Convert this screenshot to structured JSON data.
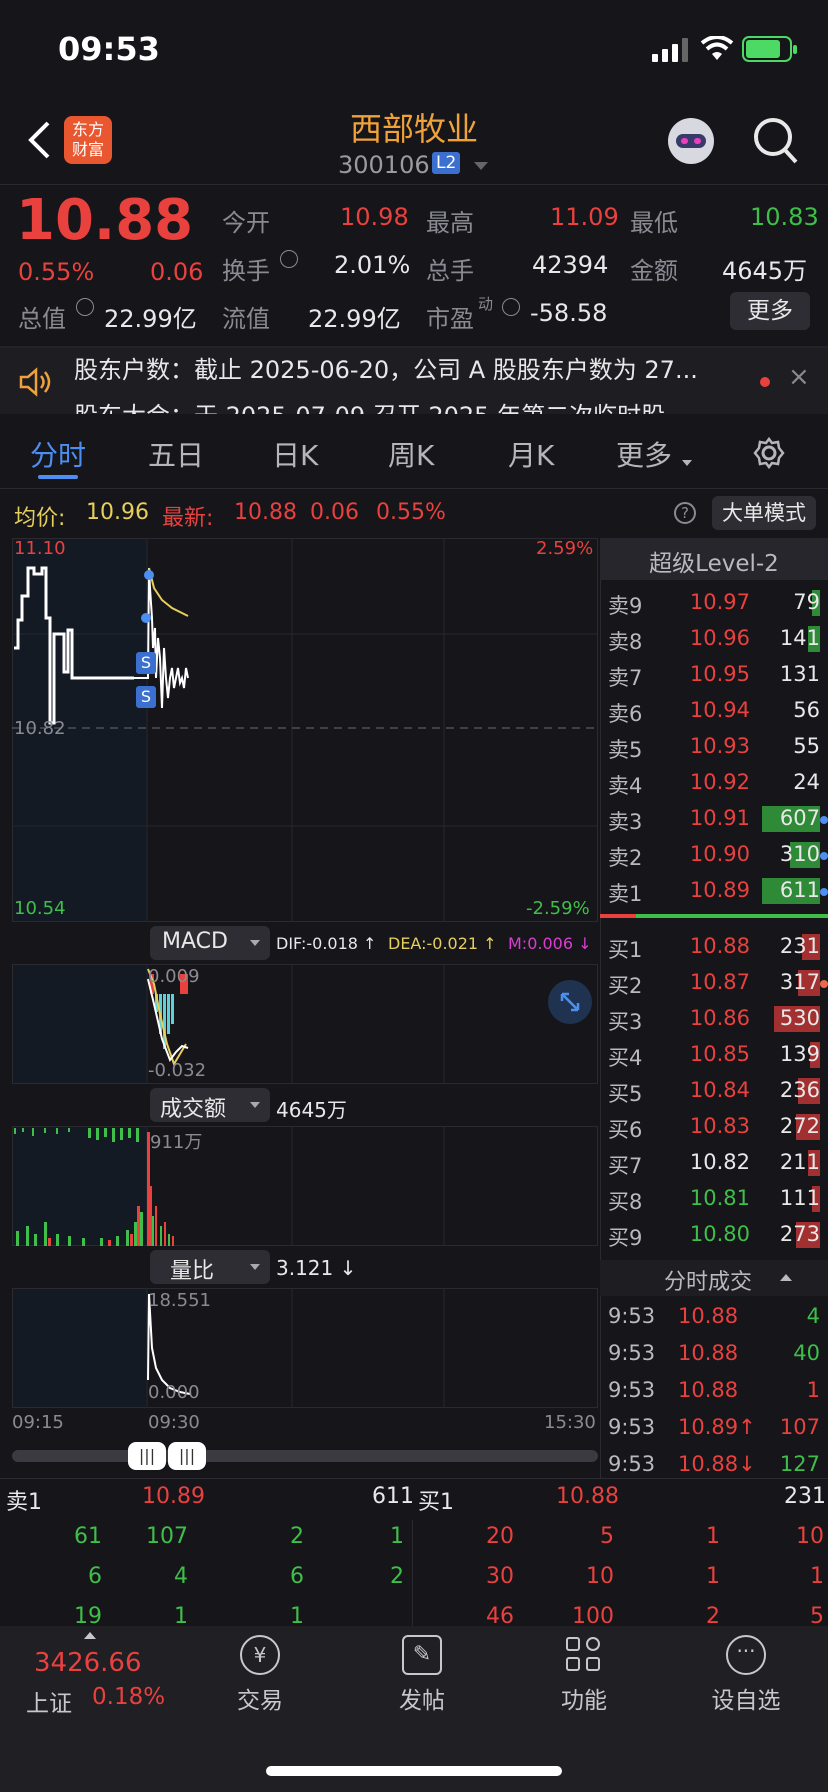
{
  "status_bar": {
    "time": "09:53"
  },
  "header": {
    "title": "西部牧业",
    "code": "300106",
    "level_badge": "L2",
    "logo_text": "东方财富"
  },
  "quote": {
    "price": "10.88",
    "change_pct": "0.55%",
    "change": "0.06",
    "open_label": "今开",
    "open": "10.98",
    "high_label": "最高",
    "high": "11.09",
    "low_label": "最低",
    "low": "10.83",
    "turnover_label": "换手",
    "turnover": "2.01%",
    "volume_label": "总手",
    "volume": "42394",
    "amount_label": "金额",
    "amount": "4645万",
    "mktcap_label": "总值",
    "mktcap": "22.99亿",
    "float_label": "流值",
    "float": "22.99亿",
    "pe_label": "市盈",
    "pe_sup": "动",
    "pe": "-58.58",
    "more_button": "更多"
  },
  "news": {
    "line1": "股东户数：截止 2025-06-20，公司 A 股股东户数为 27...",
    "line2": "股东大会：于 2025-07-09 召开 2025 年第二次临时股"
  },
  "tabs": [
    "分时",
    "五日",
    "日K",
    "周K",
    "月K",
    "更多"
  ],
  "info_line": {
    "avg_label": "均价:",
    "avg": "10.96",
    "latest_label": "最新:",
    "latest": "10.88",
    "chg": "0.06",
    "chg_pct": "0.55%",
    "mode_button": "大单模式"
  },
  "chart": {
    "price_top": "11.10",
    "price_mid": "10.82",
    "price_bottom": "10.54",
    "pct_top": "2.59%",
    "pct_bottom": "-2.59%",
    "macd_button": "MACD",
    "dif": "DIF:-0.018 ↑",
    "dea": "DEA:-0.021 ↑",
    "m": "M:0.006 ↓",
    "macd_top": "0.009",
    "macd_bottom": "-0.032",
    "amount_button": "成交额",
    "amount_value": "4645万",
    "amount_max": "911万",
    "ratio_button": "量比",
    "ratio_value": "3.121 ↓",
    "ratio_max": "18.551",
    "ratio_min": "0.000",
    "time_start": "09:15",
    "time_open": "09:30",
    "time_end": "15:30",
    "s_marker": "S"
  },
  "level2": {
    "title": "超级Level-2",
    "asks": [
      {
        "label": "卖9",
        "price": "10.97",
        "vol": "79"
      },
      {
        "label": "卖8",
        "price": "10.96",
        "vol": "141"
      },
      {
        "label": "卖7",
        "price": "10.95",
        "vol": "131"
      },
      {
        "label": "卖6",
        "price": "10.94",
        "vol": "56"
      },
      {
        "label": "卖5",
        "price": "10.93",
        "vol": "55"
      },
      {
        "label": "卖4",
        "price": "10.92",
        "vol": "24"
      },
      {
        "label": "卖3",
        "price": "10.91",
        "vol": "607"
      },
      {
        "label": "卖2",
        "price": "10.90",
        "vol": "310"
      },
      {
        "label": "卖1",
        "price": "10.89",
        "vol": "611"
      }
    ],
    "bids": [
      {
        "label": "买1",
        "price": "10.88",
        "vol": "231"
      },
      {
        "label": "买2",
        "price": "10.87",
        "vol": "317"
      },
      {
        "label": "买3",
        "price": "10.86",
        "vol": "530"
      },
      {
        "label": "买4",
        "price": "10.85",
        "vol": "139"
      },
      {
        "label": "买5",
        "price": "10.84",
        "vol": "236"
      },
      {
        "label": "买6",
        "price": "10.83",
        "vol": "272"
      },
      {
        "label": "买7",
        "price": "10.82",
        "vol": "211"
      },
      {
        "label": "买8",
        "price": "10.81",
        "vol": "111"
      },
      {
        "label": "买9",
        "price": "10.80",
        "vol": "273"
      }
    ],
    "trades_title": "分时成交",
    "trades": [
      {
        "time": "9:53",
        "price": "10.88",
        "vol": "4"
      },
      {
        "time": "9:53",
        "price": "10.88",
        "vol": "40"
      },
      {
        "time": "9:53",
        "price": "10.88",
        "vol": "1"
      },
      {
        "time": "9:53",
        "price": "10.89↑",
        "vol": "107"
      },
      {
        "time": "9:53",
        "price": "10.88↓",
        "vol": "127"
      }
    ]
  },
  "queue": {
    "sell_label": "卖1",
    "sell_price": "10.89",
    "sell_vol": "611",
    "buy_label": "买1",
    "buy_price": "10.88",
    "buy_vol": "231",
    "sell_rows": [
      [
        "61",
        "107",
        "2",
        "1"
      ],
      [
        "6",
        "4",
        "6",
        "2"
      ],
      [
        "19",
        "1",
        "1",
        ""
      ]
    ],
    "buy_rows": [
      [
        "20",
        "5",
        "1",
        "10"
      ],
      [
        "30",
        "10",
        "1",
        "1"
      ],
      [
        "46",
        "100",
        "2",
        "5"
      ]
    ]
  },
  "bottom_nav": {
    "index_value": "3426.66",
    "index_name": "上证",
    "index_pct": "0.18%",
    "items": [
      "交易",
      "发帖",
      "功能",
      "设自选"
    ]
  }
}
